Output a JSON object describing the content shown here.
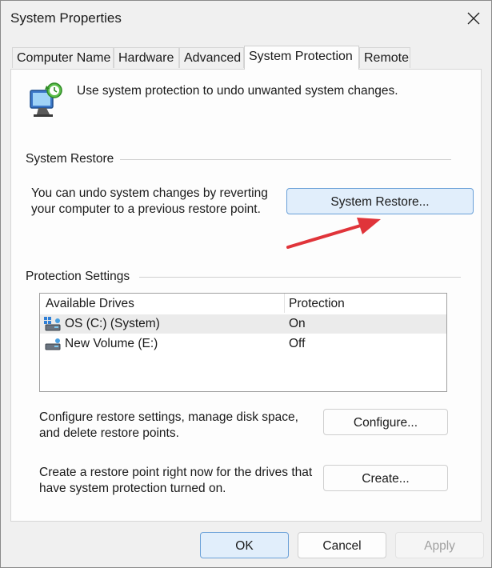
{
  "window": {
    "title": "System Properties"
  },
  "tabs": [
    {
      "label": "Computer Name"
    },
    {
      "label": "Hardware"
    },
    {
      "label": "Advanced"
    },
    {
      "label": "System Protection"
    },
    {
      "label": "Remote"
    }
  ],
  "intro": {
    "text": "Use system protection to undo unwanted system changes."
  },
  "system_restore": {
    "group_label": "System Restore",
    "desc_line1": "You can undo system changes by reverting",
    "desc_line2": "your computer to a previous restore point.",
    "button": "System Restore..."
  },
  "protection": {
    "group_label": "Protection Settings",
    "columns": [
      "Available Drives",
      "Protection"
    ],
    "drives": [
      {
        "name": "OS (C:) (System)",
        "protection": "On"
      },
      {
        "name": "New Volume (E:)",
        "protection": "Off"
      }
    ],
    "configure_line1": "Configure restore settings, manage disk space,",
    "configure_line2": "and delete restore points.",
    "configure_button": "Configure...",
    "create_line1": "Create a restore point right now for the drives that",
    "create_line2": "have system protection turned on.",
    "create_button": "Create..."
  },
  "footer": {
    "ok": "OK",
    "cancel": "Cancel",
    "apply": "Apply"
  },
  "colors": {
    "accent": "#0067c0",
    "arrow": "#e0343a"
  }
}
